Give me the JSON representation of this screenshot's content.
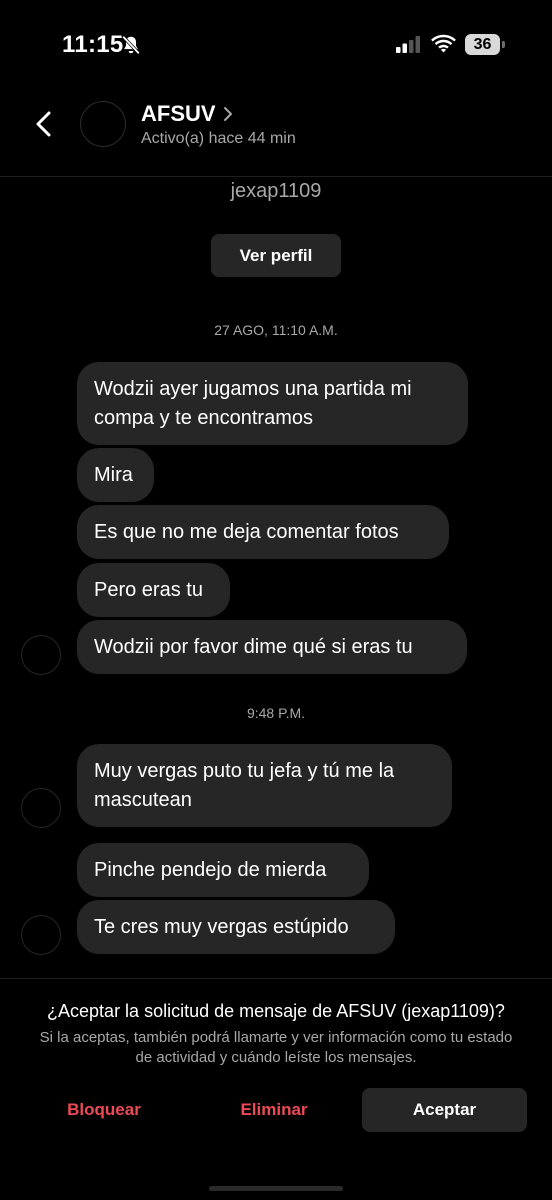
{
  "status_bar": {
    "time": "11:15",
    "battery": "36"
  },
  "header": {
    "name": "AFSUV",
    "status": "Activo(a) hace 44 min"
  },
  "profile": {
    "username": "jexap1109",
    "view_profile_label": "Ver perfil"
  },
  "timestamps": {
    "first": "27 AGO, 11:10 A.M.",
    "second": "9:48 P.M."
  },
  "messages": [
    "Wodzii ayer jugamos una partida mi compa y te encontramos",
    "Mira",
    "Es que no me deja comentar fotos",
    "Pero eras tu",
    "Wodzii por favor dime qué si eras tu",
    "Muy vergas puto tu jefa y tú me la mascutean",
    "Pinche pendejo de mierda",
    "Te cres muy vergas estúpido"
  ],
  "footer": {
    "question": "¿Aceptar la solicitud de mensaje de AFSUV (jexap1109)?",
    "info": "Si la aceptas, también podrá llamarte y ver información como tu estado de actividad y cuándo leíste los mensajes.",
    "block_label": "Bloquear",
    "delete_label": "Eliminar",
    "accept_label": "Aceptar"
  },
  "colors": {
    "background": "#000000",
    "bubble": "#262626",
    "secondary_text": "#a8a8a8",
    "destructive": "#ed4956"
  }
}
